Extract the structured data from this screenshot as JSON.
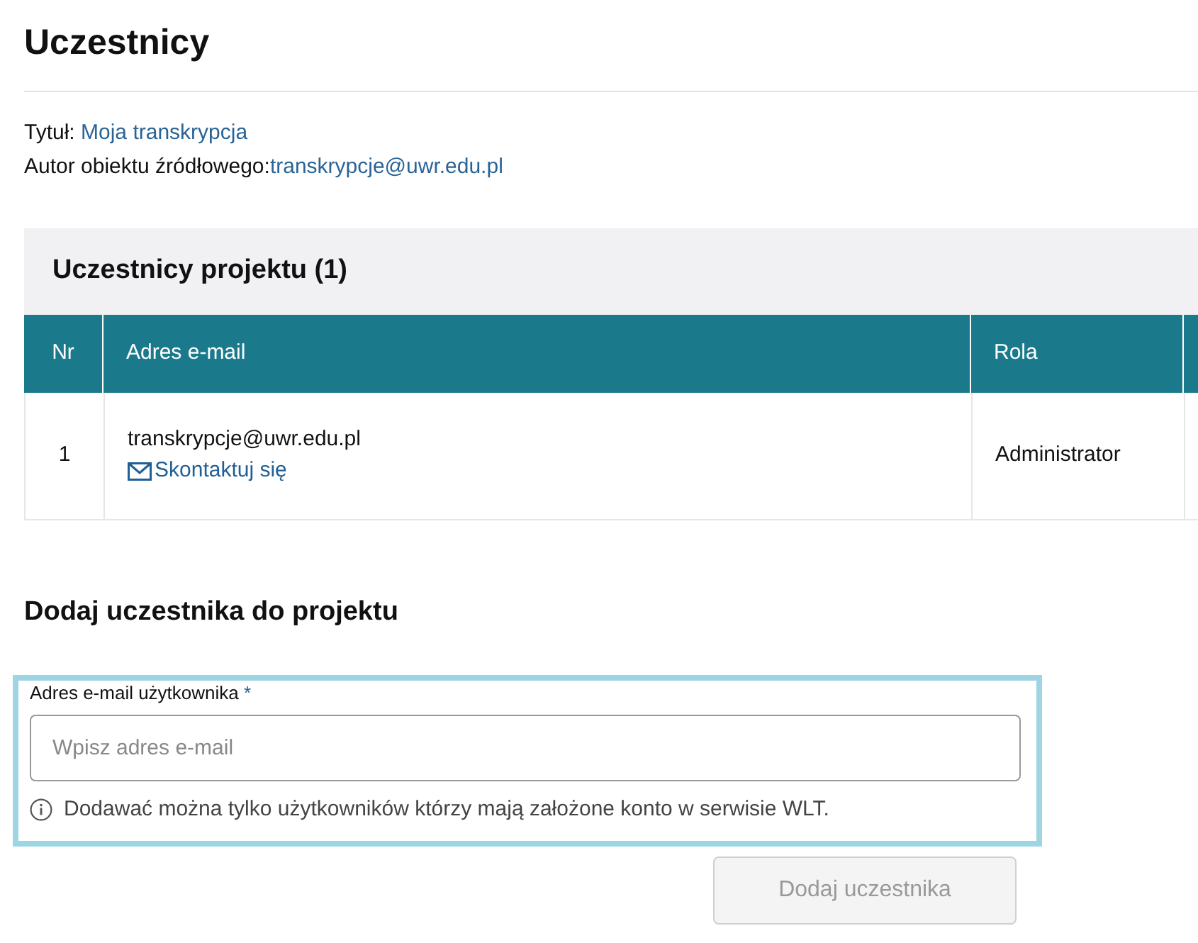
{
  "title": "Uczestnicy",
  "meta": [
    {
      "label": "Tytuł: ",
      "value": "Moja transkrypcja"
    },
    {
      "label": "Autor obiektu źródłowego:",
      "value": "transkrypcje@uwr.edu.pl"
    }
  ],
  "participants": {
    "title": "Uczestnicy projektu (1)",
    "columns": [
      "Nr",
      "Adres e-mail",
      "Rola"
    ],
    "rows": [
      {
        "nr": "1",
        "email": "transkrypcje@uwr.edu.pl",
        "contact": "Skontaktuj się",
        "role": "Administrator"
      }
    ]
  },
  "add_form": {
    "title": "Dodaj uczestnika do projektu",
    "label": "Adres e-mail użytkownika",
    "required_mark": "*",
    "placeholder": "Wpisz adres e-mail",
    "hint": "Dodawać można tylko użytkowników którzy mają założone konto w serwisie WLT.",
    "focused": true,
    "button": {
      "label": "Dodaj uczestnika",
      "disabled": true
    }
  }
}
